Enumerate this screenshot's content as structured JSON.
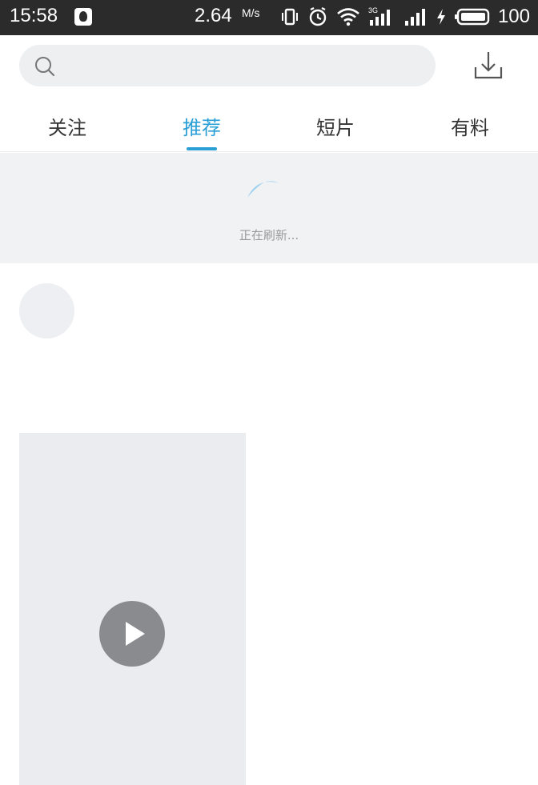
{
  "status_bar": {
    "time": "15:58",
    "net_speed": "2.64",
    "net_speed_unit": "M/s",
    "network_type": "3G",
    "battery": "100"
  },
  "search": {
    "placeholder": ""
  },
  "tabs": [
    {
      "label": "关注",
      "active": false
    },
    {
      "label": "推荐",
      "active": true
    },
    {
      "label": "短片",
      "active": false
    },
    {
      "label": "有料",
      "active": false
    }
  ],
  "refresh": {
    "text": "正在刷新..."
  },
  "colors": {
    "accent": "#2a9fd6",
    "status_bar_bg": "#2b2b2b",
    "placeholder_gray": "#ebecef",
    "play_button": "#8a8b8f"
  },
  "icons": [
    "qq-icon",
    "vibrate-icon",
    "alarm-icon",
    "wifi-icon",
    "signal-icon",
    "charging-icon",
    "battery-icon",
    "search-icon",
    "download-icon",
    "loading-spinner-icon",
    "play-icon"
  ]
}
